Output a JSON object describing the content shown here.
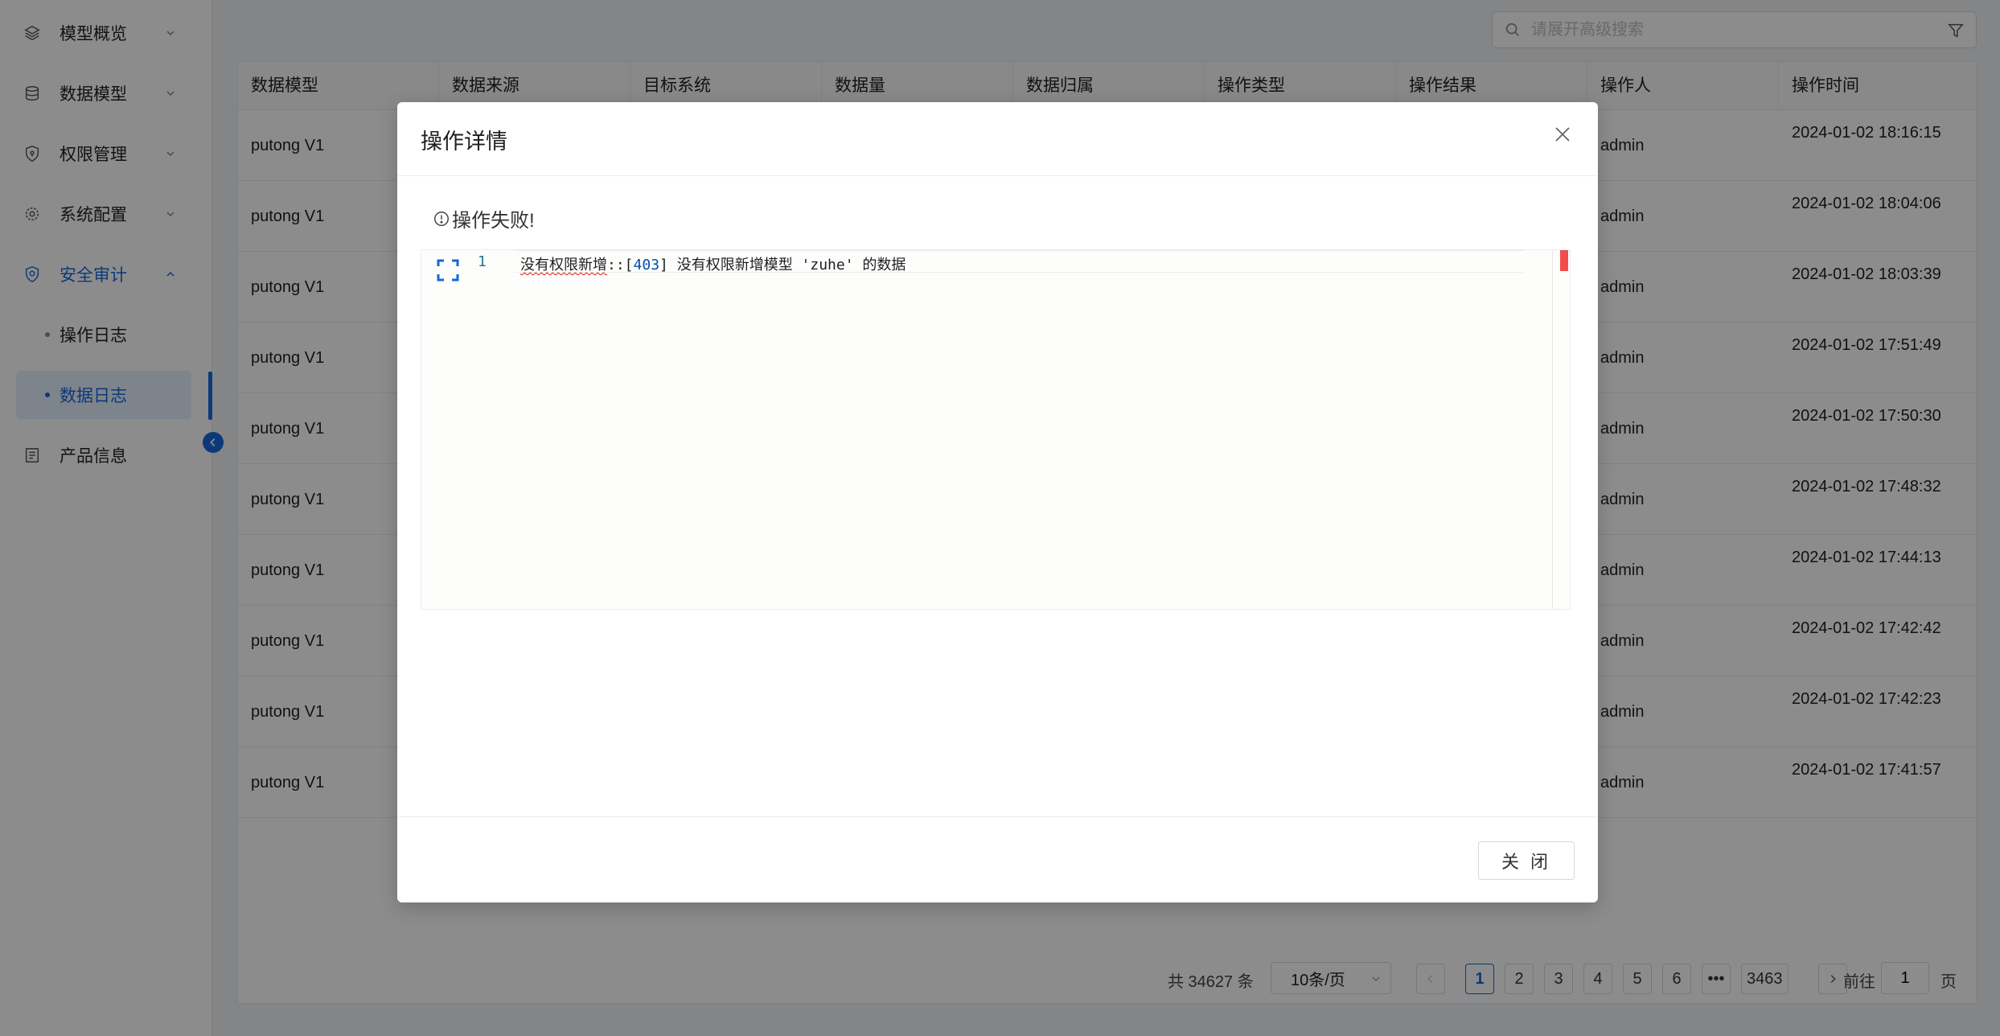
{
  "sidebar": {
    "items": [
      {
        "label": "模型概览",
        "icon": "layers-icon"
      },
      {
        "label": "数据模型",
        "icon": "database-icon"
      },
      {
        "label": "权限管理",
        "icon": "shield-lock-icon"
      },
      {
        "label": "系统配置",
        "icon": "gear-icon"
      },
      {
        "label": "安全审计",
        "icon": "shield-check-icon"
      },
      {
        "label": "产品信息",
        "icon": "document-icon"
      }
    ],
    "sub_items": [
      {
        "label": "操作日志",
        "active": false
      },
      {
        "label": "数据日志",
        "active": true
      }
    ]
  },
  "search": {
    "placeholder": "请展开高级搜索"
  },
  "table": {
    "columns": [
      "数据模型",
      "数据来源",
      "目标系统",
      "数据量",
      "数据归属",
      "操作类型",
      "操作结果",
      "操作人",
      "操作时间"
    ],
    "rows": [
      {
        "model": "putong V1",
        "operator": "admin",
        "time": "2024-01-02 18:16:15"
      },
      {
        "model": "putong V1",
        "operator": "admin",
        "time": "2024-01-02 18:04:06"
      },
      {
        "model": "putong V1",
        "operator": "admin",
        "time": "2024-01-02 18:03:39"
      },
      {
        "model": "putong V1",
        "operator": "admin",
        "time": "2024-01-02 17:51:49"
      },
      {
        "model": "putong V1",
        "operator": "admin",
        "time": "2024-01-02 17:50:30"
      },
      {
        "model": "putong V1",
        "operator": "admin",
        "time": "2024-01-02 17:48:32"
      },
      {
        "model": "putong V1",
        "operator": "admin",
        "time": "2024-01-02 17:44:13"
      },
      {
        "model": "putong V1",
        "operator": "admin",
        "time": "2024-01-02 17:42:42"
      },
      {
        "model": "putong V1",
        "operator": "admin",
        "time": "2024-01-02 17:42:23"
      },
      {
        "model": "putong V1",
        "operator": "admin",
        "time": "2024-01-02 17:41:57"
      }
    ]
  },
  "pagination": {
    "total_text": "共 34627 条",
    "page_size": "10条/页",
    "pages": [
      "1",
      "2",
      "3",
      "4",
      "5",
      "6",
      "•••",
      "3463"
    ],
    "current": "1",
    "jump_prefix": "前往",
    "jump_value": "1",
    "jump_suffix": "页"
  },
  "modal": {
    "title": "操作详情",
    "status": "操作失败!",
    "editor": {
      "line_number": "1",
      "code_part1": "没有权限新增",
      "code_part2": "::[",
      "code_num": "403",
      "code_part3": "] 没有权限新增模型 'zuhe' 的数据"
    },
    "close_button": "关 闭"
  },
  "colors": {
    "accent": "#1668dc",
    "error": "#f14c4c"
  }
}
